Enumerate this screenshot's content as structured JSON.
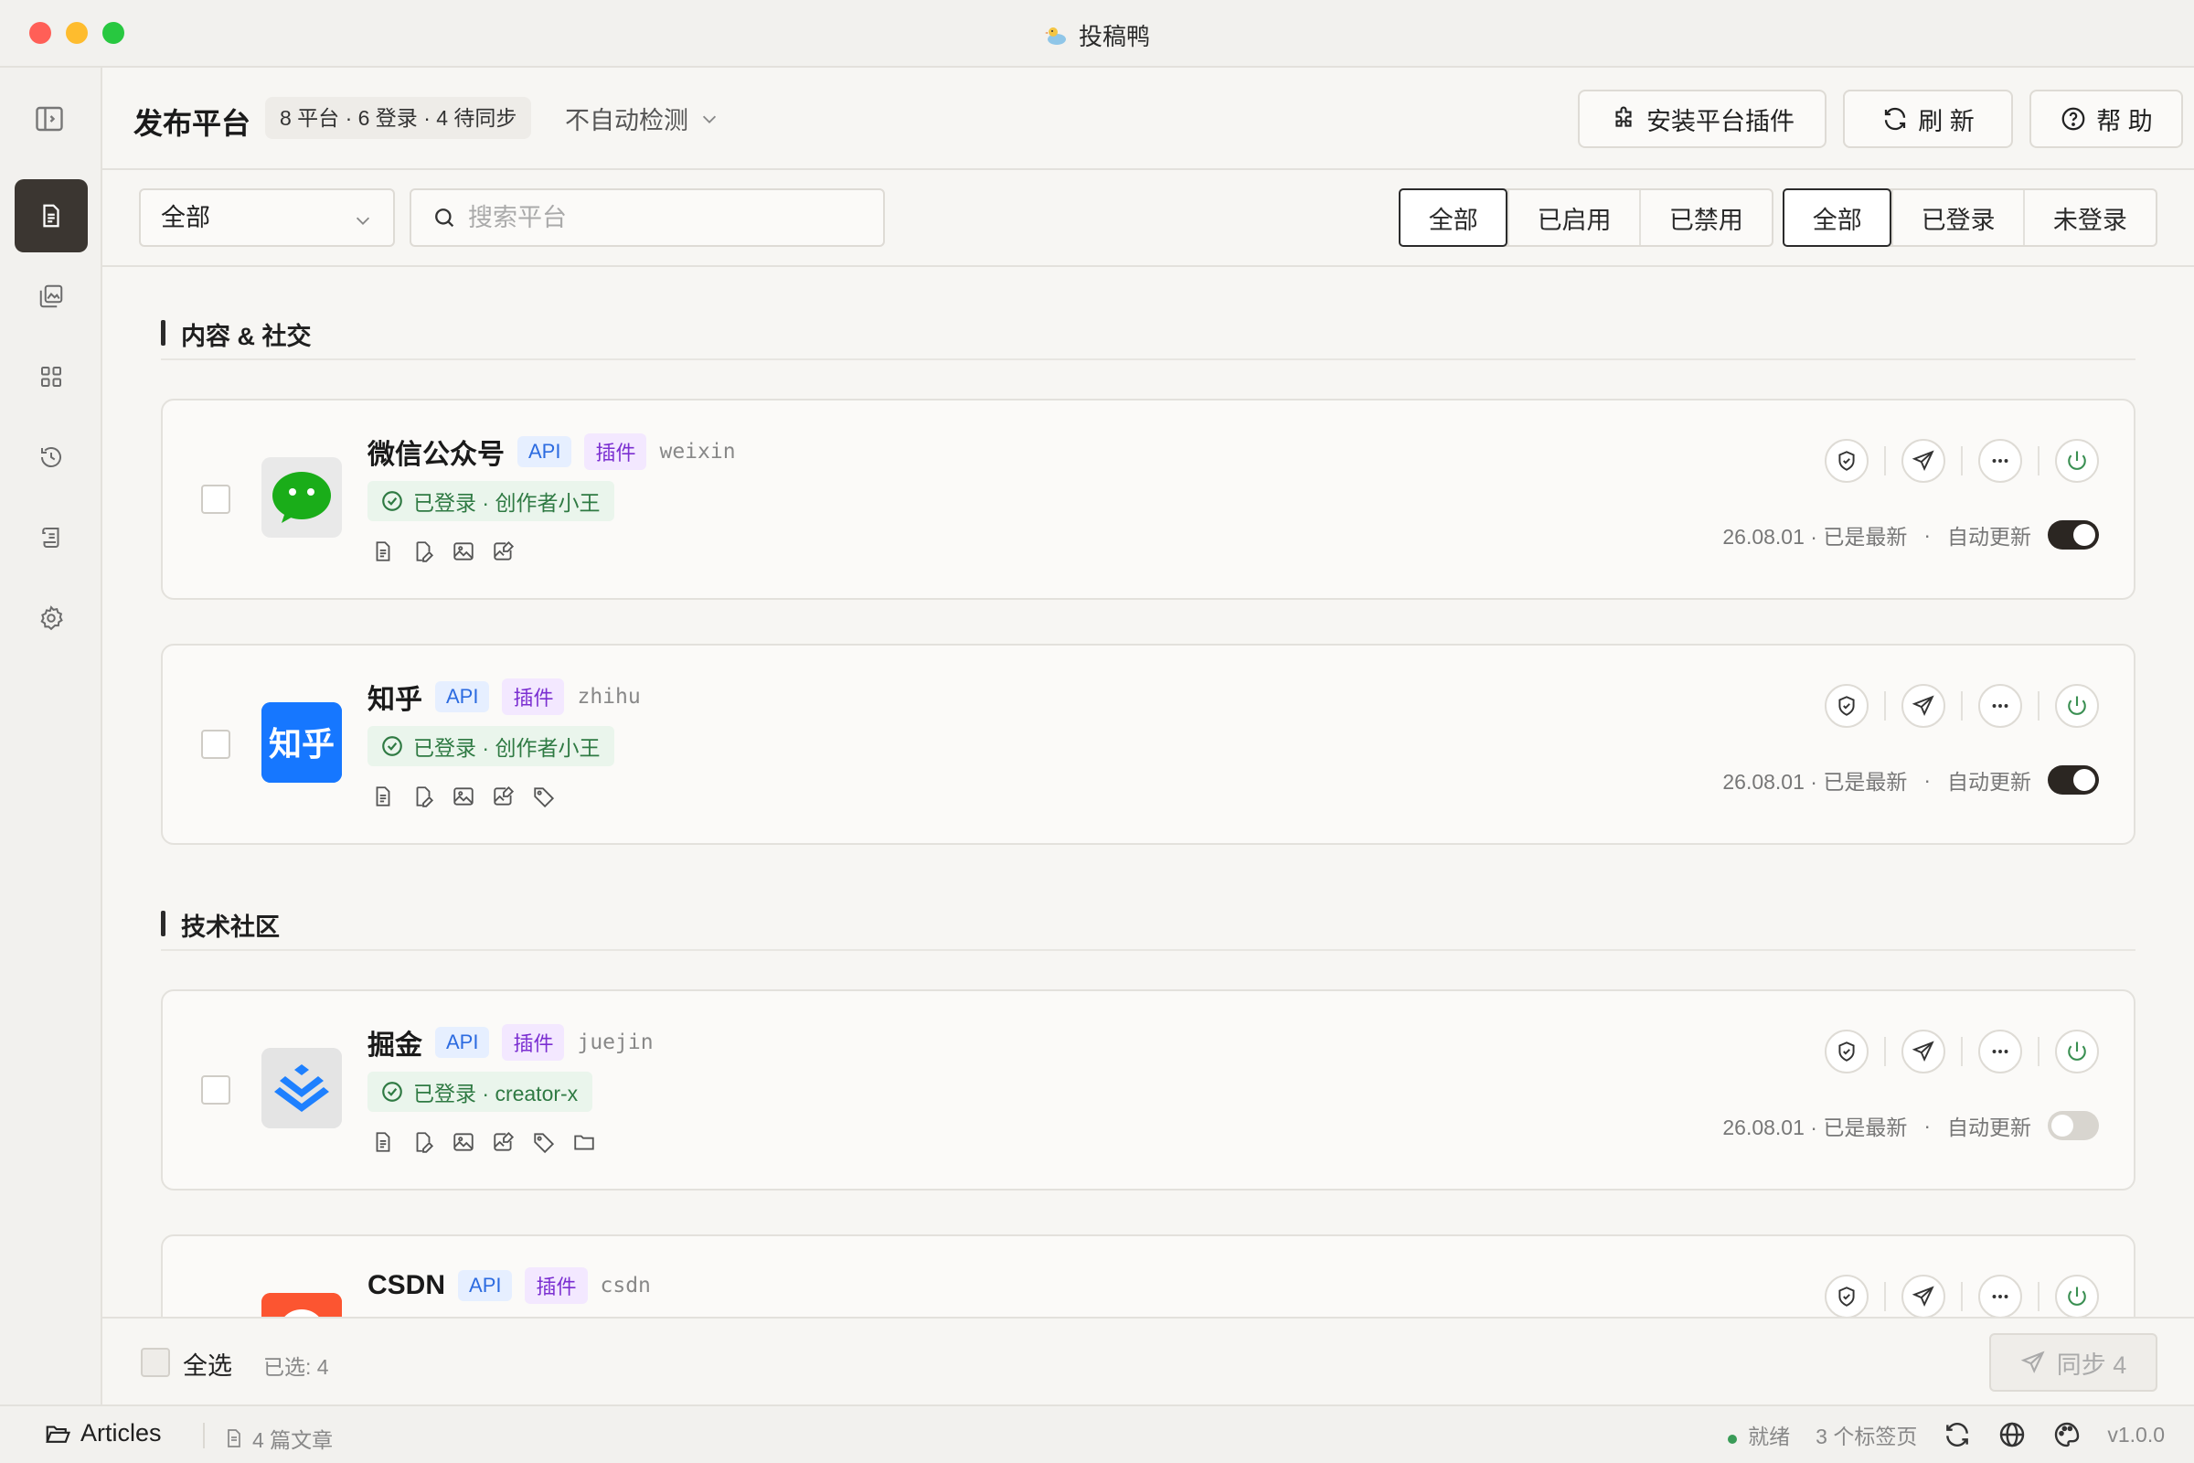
{
  "window": {
    "title": "投稿鸭"
  },
  "header": {
    "title": "发布平台",
    "summary": "8 平台 · 6 登录 · 4 待同步",
    "auto_detect": "不自动检测",
    "install_plugin": "安装平台插件",
    "refresh": "刷 新",
    "help": "帮 助"
  },
  "filters": {
    "category": "全部",
    "search_placeholder": "搜索平台",
    "status_group": [
      "全部",
      "已启用",
      "已禁用"
    ],
    "status_selected": "全部",
    "login_group": [
      "全部",
      "已登录",
      "未登录"
    ],
    "login_selected": "全部"
  },
  "sections": [
    {
      "title": "内容 & 社交",
      "platforms": [
        {
          "name": "微信公众号",
          "api": "API",
          "plugin": "插件",
          "id": "weixin",
          "login": "已登录 · 创作者小王",
          "version": "26.08.01 · 已是最新",
          "auto_update": "自动更新",
          "auto_update_on": true,
          "capabilities": [
            "article-icon",
            "edit-icon",
            "image-icon",
            "image-edit-icon"
          ]
        },
        {
          "name": "知乎",
          "api": "API",
          "plugin": "插件",
          "id": "zhihu",
          "login": "已登录 · 创作者小王",
          "version": "26.08.01 · 已是最新",
          "auto_update": "自动更新",
          "auto_update_on": true,
          "capabilities": [
            "article-icon",
            "edit-icon",
            "image-icon",
            "image-edit-icon",
            "tag-icon"
          ]
        }
      ]
    },
    {
      "title": "技术社区",
      "platforms": [
        {
          "name": "掘金",
          "api": "API",
          "plugin": "插件",
          "id": "juejin",
          "login": "已登录 · creator-x",
          "version": "26.08.01 · 已是最新",
          "auto_update": "自动更新",
          "auto_update_on": false,
          "capabilities": [
            "article-icon",
            "edit-icon",
            "image-icon",
            "image-edit-icon",
            "tag-icon",
            "folder-icon"
          ]
        },
        {
          "name": "CSDN",
          "api": "API",
          "plugin": "插件",
          "id": "csdn"
        }
      ]
    }
  ],
  "actionbar": {
    "select_all": "全选",
    "selected": "已选: 4",
    "sync": "同步 4"
  },
  "statusbar": {
    "folder": "Articles",
    "articles": "4 篇文章",
    "status": "就绪",
    "tabs": "3 个标签页",
    "version": "v1.0.0"
  },
  "colors": {
    "accent_dark": "#3b3631",
    "login_green": "#2f7a43",
    "api_blue": "#2c6be0",
    "plugin_purple": "#7b2fd1"
  }
}
